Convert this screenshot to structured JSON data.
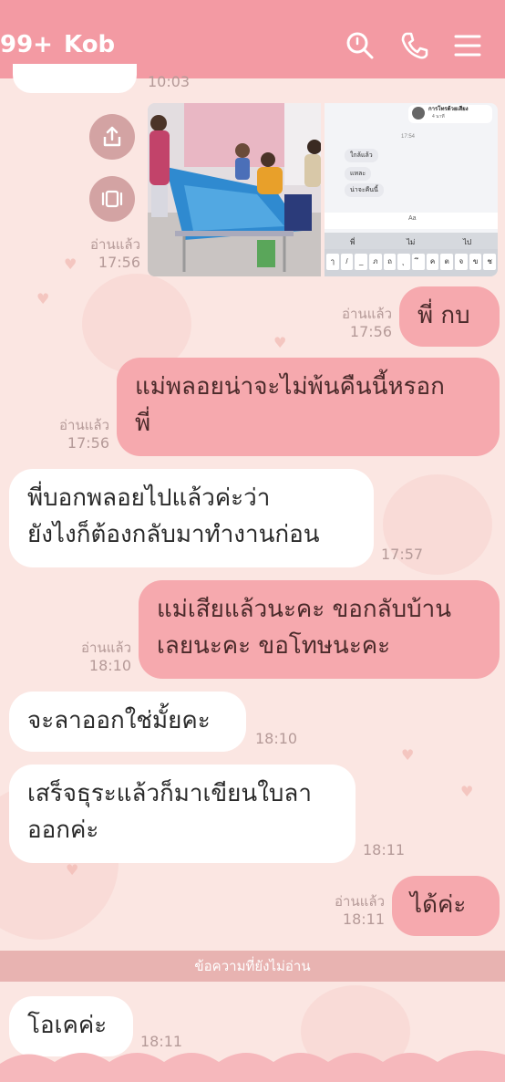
{
  "header": {
    "unread_count": "99+",
    "contact_name": "Kob",
    "search_icon": "search-icon",
    "call_icon": "phone-icon",
    "menu_icon": "menu-icon"
  },
  "top_partial": {
    "time": "10:03"
  },
  "photo_message": {
    "read": "อ่านแล้ว",
    "time": "17:56",
    "screenshot": {
      "call_label": "การโทรด้วยเสียง",
      "call_duration": "4 นาที",
      "time": "17:54",
      "lines": [
        "ใกล้แล้ว",
        "แหละ",
        "น่าจะคืนนี้"
      ],
      "input_placeholder": "Aa",
      "suggest": [
        "พี่",
        "ไม่",
        "ไป"
      ],
      "keys": [
        "ๅ",
        "/",
        "_",
        "ภ",
        "ถ",
        "ุ",
        "ึ",
        "ค",
        "ต",
        "จ",
        "ข",
        "ช"
      ]
    }
  },
  "messages": [
    {
      "side": "out",
      "text": "พี่ กบ",
      "read": "อ่านแล้ว",
      "time": "17:56"
    },
    {
      "side": "out",
      "text": "แม่พลอยน่าจะไม่พ้นคืนนี้หรอกพี่",
      "line1": "แม่พลอยน่าจะไม่พ้นคืนนี้หรอก",
      "line2": "พี่",
      "read": "อ่านแล้ว",
      "time": "17:56"
    },
    {
      "side": "in",
      "line1": "พี่บอกพลอยไปแล้วค่ะว่า",
      "line2": "ยังไงก็ต้องกลับมาทำงานก่อน",
      "time": "17:57"
    },
    {
      "side": "out",
      "line1": "แม่เสียแล้วนะคะ ขอกลับบ้าน",
      "line2": "เลยนะคะ  ขอโทษนะคะ",
      "read": "อ่านแล้ว",
      "time": "18:10"
    },
    {
      "side": "in",
      "text": "จะลาออกใช่มั้ยคะ",
      "time": "18:10"
    },
    {
      "side": "in",
      "line1": "เสร็จธุระแล้วก็มาเขียนใบลา",
      "line2": "ออกค่ะ",
      "time": "18:11"
    },
    {
      "side": "out",
      "text": "ได้ค่ะ",
      "read": "อ่านแล้ว",
      "time": "18:11"
    },
    {
      "side": "in",
      "text": "โอเคค่ะ",
      "time": "18:11"
    }
  ],
  "unread_divider": "ข้อความที่ยังไม่อ่าน",
  "colors": {
    "header": "#f39aa3",
    "background": "#fbe6e2",
    "outgoing_bubble": "#f6a9ae",
    "incoming_bubble": "#ffffff",
    "meta_text": "#b59a98"
  }
}
